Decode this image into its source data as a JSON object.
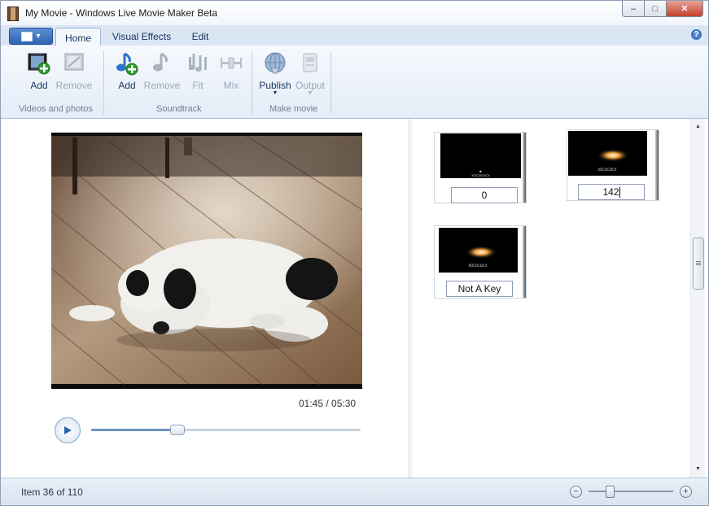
{
  "window": {
    "title": "My Movie - Windows Live Movie Maker Beta"
  },
  "tabs": [
    {
      "label": "Home",
      "active": true
    },
    {
      "label": "Visual Effects",
      "active": false
    },
    {
      "label": "Edit",
      "active": false
    }
  ],
  "ribbon": {
    "groups": [
      {
        "label": "Videos and photos",
        "buttons": [
          {
            "label": "Add",
            "icon": "add-video-icon",
            "enabled": true
          },
          {
            "label": "Remove",
            "icon": "remove-video-icon",
            "enabled": false
          }
        ]
      },
      {
        "label": "Soundtrack",
        "buttons": [
          {
            "label": "Add",
            "icon": "add-music-icon",
            "enabled": true
          },
          {
            "label": "Remove",
            "icon": "remove-music-icon",
            "enabled": false
          },
          {
            "label": "Fit",
            "icon": "fit-icon",
            "enabled": false
          },
          {
            "label": "Mix",
            "icon": "mix-icon",
            "enabled": false
          }
        ]
      },
      {
        "label": "Make movie",
        "buttons": [
          {
            "label": "Publish",
            "icon": "publish-globe-icon",
            "enabled": true
          },
          {
            "label": "Output",
            "icon": "output-icon",
            "enabled": false
          }
        ]
      }
    ]
  },
  "preview": {
    "timecode": "01:45 / 05:30",
    "progress": 0.318
  },
  "storyboard": {
    "items": [
      {
        "text": "0",
        "selected": false
      },
      {
        "text": "142",
        "selected": true
      },
      {
        "text": "Not A Key",
        "selected": false
      }
    ]
  },
  "status": {
    "item_text": "Item 36 of 110",
    "zoom_level": 0.25
  },
  "colors": {
    "accent": "#2e64b4",
    "ribbon_bg": "#e4ecf7",
    "close_button": "#c5412c"
  }
}
